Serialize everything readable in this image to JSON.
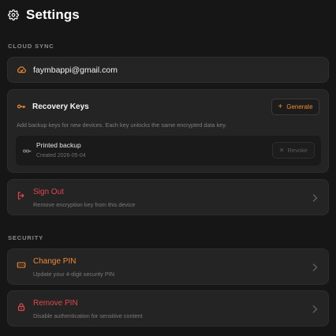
{
  "header": {
    "title": "Settings",
    "icon": "gear-icon"
  },
  "sections": {
    "cloud_sync": "CLOUD SYNC",
    "security": "SECURITY"
  },
  "account": {
    "email": "faymbappi@gmail.com",
    "icon": "cloud-icon"
  },
  "recovery": {
    "title": "Recovery Keys",
    "icon": "key-icon",
    "generate_label": "Generate",
    "description": "Add backup keys for new devices. Each key unlocks the same encrypted data key.",
    "keys": [
      {
        "name": "Printed backup",
        "created": "Created 2026-05-04",
        "revoke_label": "Revoke"
      }
    ]
  },
  "sign_out": {
    "title": "Sign Out",
    "subtitle": "Remove encryption key from this device",
    "icon": "sign-out-icon"
  },
  "change_pin": {
    "title": "Change PIN",
    "subtitle": "Update your 4-digit security PIN",
    "icon": "pin-pad-icon"
  },
  "remove_pin": {
    "title": "Remove PIN",
    "subtitle": "Disable authentication for sensitive content",
    "icon": "lock-icon"
  },
  "colors": {
    "background": "#161616",
    "card": "#242424",
    "accent_orange": "#f08a2e",
    "danger_red": "#e0484b"
  }
}
